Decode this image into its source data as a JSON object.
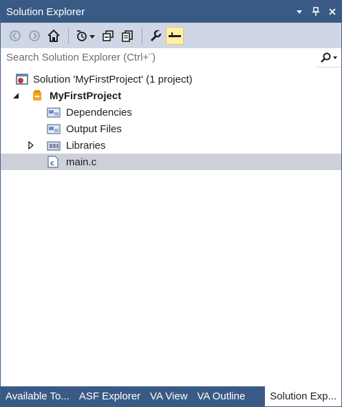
{
  "window": {
    "title": "Solution Explorer",
    "title_buttons": [
      "dropdown-icon",
      "pin-icon",
      "close-icon"
    ]
  },
  "toolbar": {
    "buttons": [
      "back-icon",
      "forward-icon",
      "home-icon",
      "pending-changes-filter-icon",
      "collapse-all-icon",
      "show-all-files-icon",
      "properties-icon",
      "preview-selected-items-icon"
    ],
    "active_button": "preview-selected-items-icon"
  },
  "search": {
    "placeholder": "Search Solution Explorer (Ctrl+¨)"
  },
  "tree": {
    "solution_label": "Solution 'MyFirstProject' (1 project)",
    "project_label": "MyFirstProject",
    "items": [
      {
        "label": "Dependencies"
      },
      {
        "label": "Output Files"
      },
      {
        "label": "Libraries"
      },
      {
        "label": "main.c"
      }
    ],
    "selected": "main.c"
  },
  "tabs": [
    {
      "label": "Available To..."
    },
    {
      "label": "ASF Explorer"
    },
    {
      "label": "VA View"
    },
    {
      "label": "VA Outline"
    },
    {
      "label": "Solution Exp..."
    }
  ],
  "colors": {
    "title_bar": "#3a5a86",
    "toolbar": "#cfd6e5",
    "selection": "#cdd0d9",
    "active_tool": "#fff0a8"
  }
}
